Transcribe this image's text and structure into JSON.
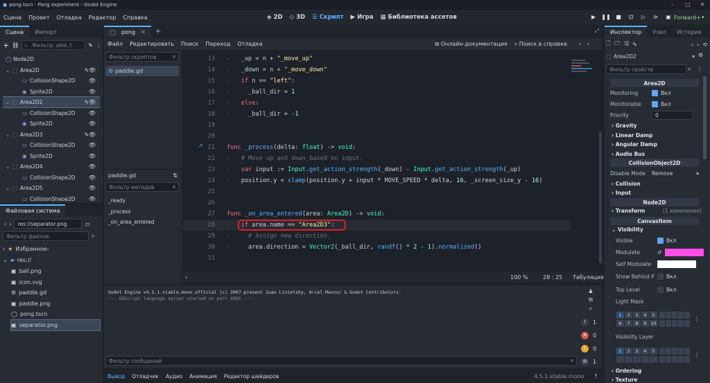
{
  "window": {
    "title": "pong.tscn - Pong experiment - Godot Engine",
    "min": "–",
    "max": "□",
    "close": "✕"
  },
  "menu": [
    "Сцена",
    "Проект",
    "Отладка",
    "Редактор",
    "Справка"
  ],
  "workspaces": [
    {
      "label": "2D",
      "icon": "◈"
    },
    {
      "label": "3D",
      "icon": "◇"
    },
    {
      "label": "Скрипт",
      "icon": "☰"
    },
    {
      "label": "Игра",
      "icon": "▶"
    },
    {
      "label": "Библиотека ассетов",
      "icon": "▦"
    }
  ],
  "renderer": "Forward+",
  "scene_panel": {
    "tabs": [
      "Сцена",
      "Импорт"
    ],
    "filter_placeholder": "Фильтр: имя, t",
    "nodes": [
      {
        "label": "Node2D",
        "depth": 0,
        "kind": "node2d"
      },
      {
        "label": "Area2D",
        "depth": 1,
        "kind": "area"
      },
      {
        "label": "CollisionShape2D",
        "depth": 2,
        "kind": "col"
      },
      {
        "label": "Sprite2D",
        "depth": 2,
        "kind": "spr"
      },
      {
        "label": "Area2D2",
        "depth": 1,
        "kind": "area"
      },
      {
        "label": "CollisionShape2D",
        "depth": 2,
        "kind": "col"
      },
      {
        "label": "Sprite2D",
        "depth": 2,
        "kind": "spr"
      },
      {
        "label": "Area2D3",
        "depth": 1,
        "kind": "area"
      },
      {
        "label": "CollisionShape2D",
        "depth": 2,
        "kind": "col"
      },
      {
        "label": "Sprite2D",
        "depth": 2,
        "kind": "spr"
      },
      {
        "label": "Area2D4",
        "depth": 1,
        "kind": "area"
      },
      {
        "label": "CollisionShape2D",
        "depth": 2,
        "kind": "col"
      },
      {
        "label": "Area2D5",
        "depth": 1,
        "kind": "area"
      },
      {
        "label": "CollisionShape2D",
        "depth": 2,
        "kind": "col"
      }
    ]
  },
  "fs_panel": {
    "title": "Файловая система",
    "path": "res://separator.png",
    "filter_placeholder": "Фильтр файлов",
    "favorites": "Избранное:",
    "root": "res://",
    "files": [
      "ball.png",
      "icon.svg",
      "paddle.gd",
      "paddle.png",
      "pong.tscn",
      "separator.png"
    ]
  },
  "script_tabs": [
    "pong"
  ],
  "script_menu": [
    "Файл",
    "Редактировать",
    "Поиск",
    "Переход",
    "Отладка"
  ],
  "script_menu_right": [
    "Онлайн-документация",
    "Поиск в справке"
  ],
  "script_list": {
    "filter_placeholder": "Фильтр скриптов",
    "items": [
      "paddle.gd"
    ],
    "current": "paddle.gd",
    "methods_placeholder": "Фильтр методов",
    "methods": [
      "_ready",
      "_process",
      "_on_area_entered"
    ]
  },
  "code": {
    "lines": [
      {
        "n": "13",
        "html": "    <span class='id'>_up</span> = n + <span class='str'>\"_move_up\"</span>"
      },
      {
        "n": "14",
        "html": "    <span class='id'>_down</span> = n + <span class='str'>\"_move_down\"</span>"
      },
      {
        "n": "15",
        "html": "    <span class='kw'>if</span> n == <span class='str'>\"left\"</span>:"
      },
      {
        "n": "16",
        "html": "      <span class='id'>_ball_dir</span> = <span class='num'>1</span>"
      },
      {
        "n": "17",
        "html": "    <span class='kw'>else</span>:"
      },
      {
        "n": "18",
        "html": "      <span class='id'>_ball_dir</span> = -<span class='num'>1</span>"
      },
      {
        "n": "19",
        "html": ""
      },
      {
        "n": "20",
        "html": ""
      },
      {
        "n": "21",
        "html": "<span class='kw'>func</span> <span class='fn'>_process</span>(delta: <span class='ty'>float</span>) -> <span class='ty'>void</span>:"
      },
      {
        "n": "22",
        "html": "    <span class='cm'># Move up and down based on input.</span>"
      },
      {
        "n": "23",
        "html": "    <span class='kw'>var</span> input := <span class='ty'>Input</span>.<span class='fn'>get_action_strength</span>(_down) - <span class='ty'>Input</span>.<span class='fn'>get_action_strength</span>(_up)"
      },
      {
        "n": "24",
        "html": "    position.y = <span class='fn'>clamp</span>(position.y + input * MOVE_SPEED * delta, <span class='num'>16</span>, _screen_size_y - <span class='num'>16</span>)"
      },
      {
        "n": "25",
        "html": ""
      },
      {
        "n": "26",
        "html": ""
      },
      {
        "n": "27",
        "html": "<span class='kw'>func</span> <span class='fn'>_on_area_entered</span>(area: <span class='ty'>Area2D</span>) -> <span class='ty'>void</span>:"
      },
      {
        "n": "28",
        "html": "    <span class='kw'>if</span> area.name == <span class='str'>\"Area2D3\"</span>:"
      },
      {
        "n": "29",
        "html": "      <span class='cm'># Assign new direction.</span>"
      },
      {
        "n": "30",
        "html": "      area.direction = <span class='ty'>Vector2</span>(_ball_dir, <span class='fn'>randf</span>() * <span class='num'>2</span> - <span class='num'>1</span>).<span class='fn'>normalized</span>()"
      },
      {
        "n": "31",
        "html": ""
      }
    ],
    "zoom": "100 %",
    "cursor": "28 :  25",
    "indent": "Табуляция"
  },
  "output": {
    "lines": [
      "Godot Engine v4.5.1.stable.mono.official (c) 2007-present Juan Linietsky, Ariel Manzur & Godot Contributors.",
      "--- GDScript language server started on port 6005 ---"
    ],
    "filter_placeholder": "Фильтр сообщений",
    "counts": [
      "1",
      "0",
      "0",
      "1"
    ]
  },
  "bottom_tabs": [
    "Вывод",
    "Отладчик",
    "Аудио",
    "Анимация",
    "Редактор шейдеров"
  ],
  "version": "4.5.1.stable.mono",
  "inspector": {
    "tabs": [
      "Инспектор",
      "Узел",
      "История"
    ],
    "node": "Area2D2",
    "filter_placeholder": "Фильтр свойств",
    "sec_area": "Area2D",
    "monitoring": "Monitoring",
    "monitorable": "Monitorable",
    "on": "Вкл",
    "priority": "Priority",
    "priority_val": "0",
    "groups1": [
      "Gravity",
      "Linear Damp",
      "Angular Damp",
      "Audio Bus"
    ],
    "sec_col": "CollisionObject2D",
    "disable_mode": "Disable Mode",
    "disable_val": "Remove",
    "collision": "Collision",
    "input": "Input",
    "sec_node": "Node2D",
    "transform": "Transform",
    "transform_note": "(1 изменение)",
    "sec_canvas": "CanvasItem",
    "visibility": "Visibility",
    "visible": "Visible",
    "modulate": "Modulate",
    "self_modulate": "Self Modulate",
    "show_behind": "Show Behind P",
    "top_level": "Top Level",
    "light_mask": "Light Mask",
    "visibility_layer": "Visibility Layer",
    "ordering": "Ordering",
    "texture": "Texture",
    "modulate_color": "#ff4de8",
    "self_modulate_color": "#ffffff",
    "mask_nums": [
      "1",
      "2",
      "3",
      "4",
      "5",
      "6",
      "7",
      "8",
      "9",
      "10"
    ]
  }
}
